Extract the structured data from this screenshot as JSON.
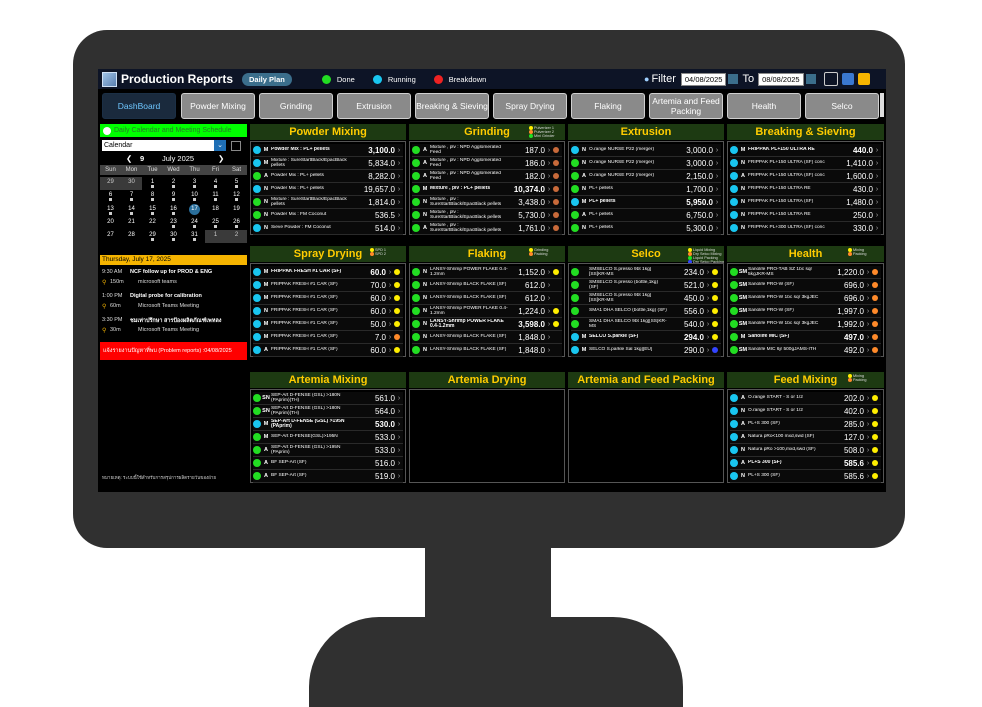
{
  "app": {
    "title": "Production Reports",
    "daily_plan": "Daily Plan",
    "legend": {
      "done": "Done",
      "running": "Running",
      "breakdown": "Breakdown"
    },
    "filter_label": "Filter",
    "date_from": "04/08/2025",
    "to_label": "To",
    "date_to": "08/08/2025"
  },
  "colors": {
    "done": "#22dd22",
    "running": "#19c6f0",
    "breakdown": "#ee2222",
    "yellow": "#ffee00",
    "orange": "#ff8a2a",
    "brown": "#c86a3a",
    "blue": "#3344ff",
    "header_bg": "#1d3a12",
    "header_text": "#ffcc00"
  },
  "tabs": [
    "DashBoard",
    "Powder Mixing",
    "Grinding",
    "Extrusion",
    "Breaking & Sieving",
    "Spray Drying",
    "Flaking",
    "Artemia and Feed Packing",
    "Health",
    "Selco"
  ],
  "calendar": {
    "header": "Daily Calendar and Meeting Schedule",
    "select": "Calendar",
    "day": "9",
    "month": "July 2025",
    "weekdays": [
      "Sun",
      "Mon",
      "Tue",
      "Wed",
      "Thu",
      "Fri",
      "Sat"
    ],
    "weeks": [
      [
        "29",
        "30",
        "1",
        "2",
        "3",
        "4",
        "5"
      ],
      [
        "6",
        "7",
        "8",
        "9",
        "10",
        "11",
        "12"
      ],
      [
        "13",
        "14",
        "15",
        "16",
        "17",
        "18",
        "19"
      ],
      [
        "20",
        "21",
        "22",
        "23",
        "24",
        "25",
        "26"
      ],
      [
        "27",
        "28",
        "29",
        "30",
        "31",
        "1",
        "2"
      ]
    ],
    "event_date": "Thursday, July 17, 2025",
    "events": [
      {
        "time": "9:30 AM",
        "title": "NCF follow up for PROD & ENG",
        "duration": "150m",
        "sub": "microsoft teams"
      },
      {
        "time": "1:00 PM",
        "title": "Digital probe for calibration",
        "duration": "60m",
        "sub": "Microsoft Teams Meeting"
      },
      {
        "time": "3:30 PM",
        "title": "ชมเท่าปรึกษา สารป้องผลิตภัณฑ์เพหลง",
        "duration": "30m",
        "sub": "Microsoft Teams Meeting"
      }
    ],
    "problem": "แจ้งรายงานปัญหาที่พบ (Problem reports) :04/08/2025",
    "footnote": "หมายเหตุ: ระบบนี้ใช้สำหรับการสรุปการผลิตรายวันของฝ่าย"
  },
  "sections": {
    "powder_mixing": {
      "title": "Powder Mixing",
      "rows": [
        {
          "code": "M",
          "name": "Powder Mix : PL+ pellets",
          "value": "3,100.0",
          "status": "running",
          "bold": true
        },
        {
          "code": "M",
          "name": "Mixture : SureStartBlack/EpacBlack pellets",
          "value": "5,834.0",
          "status": "running"
        },
        {
          "code": "A",
          "name": "Powder Mix : PL+ pellets",
          "value": "8,282.0",
          "status": "done"
        },
        {
          "code": "N",
          "name": "Powder Mix : PL+ pellets",
          "value": "19,657.0",
          "status": "running"
        },
        {
          "code": "N",
          "name": "Mixture : SureStartBlack/EpacBlack pellets",
          "value": "1,814.0",
          "status": "done"
        },
        {
          "code": "N",
          "name": "Powder Mix : FM Coconut",
          "value": "536.5",
          "status": "done"
        },
        {
          "code": "N",
          "name": "Sieve Powder : FM Coconut",
          "value": "514.0",
          "status": "running"
        }
      ]
    },
    "grinding": {
      "title": "Grinding",
      "legend": [
        "Pulverizer 1",
        "Pulverizer 2",
        "Mini Grinder"
      ],
      "rows": [
        {
          "code": "A",
          "name": "Mixture , plv : NPD Agglomerated Feed",
          "value": "187.0",
          "status": "done",
          "ind": "brown"
        },
        {
          "code": "A",
          "name": "Mixture , plv : NPD Agglomerated Feed",
          "value": "186.0",
          "status": "done",
          "ind": "brown"
        },
        {
          "code": "A",
          "name": "Mixture , plv : NPD Agglomerated Feed",
          "value": "182.0",
          "status": "done",
          "ind": "brown"
        },
        {
          "code": "M",
          "name": "Mixture , plv : PL+ pellets",
          "value": "10,374.0",
          "status": "done",
          "ind": "brown",
          "bold": true
        },
        {
          "code": "N",
          "name": "Mixture , plv : SureStartBlack/EpacBlack pellets",
          "value": "3,438.0",
          "status": "done",
          "ind": "brown"
        },
        {
          "code": "N",
          "name": "Mixture , plv : SureStartBlack/EpacBlack pellets",
          "value": "5,730.0",
          "status": "done",
          "ind": "brown"
        },
        {
          "code": "A",
          "name": "Mixture , plv : SureStartBlack/EpacBlack pellets",
          "value": "1,761.0",
          "status": "done",
          "ind": "brown"
        }
      ]
    },
    "extrusion": {
      "title": "Extrusion",
      "rows": [
        {
          "code": "N",
          "name": "O.range NURSE P22 (merger)",
          "value": "3,000.0",
          "status": "running"
        },
        {
          "code": "N",
          "name": "O.range NURSE P22 (merger)",
          "value": "3,000.0",
          "status": "done"
        },
        {
          "code": "A",
          "name": "O.range NURSE P22 (merger)",
          "value": "2,150.0",
          "status": "done"
        },
        {
          "code": "N",
          "name": "PL+ pellets",
          "value": "1,700.0",
          "status": "done"
        },
        {
          "code": "M",
          "name": "PL+ pellets",
          "value": "5,950.0",
          "status": "running",
          "bold": true
        },
        {
          "code": "A",
          "name": "PL+ pellets",
          "value": "6,750.0",
          "status": "done"
        },
        {
          "code": "N",
          "name": "PL+ pellets",
          "value": "5,300.0",
          "status": "done"
        }
      ]
    },
    "breaking": {
      "title": "Breaking & Sieving",
      "rows": [
        {
          "code": "M",
          "name": "FRIPPAK PL+150 ULTRA RE",
          "value": "440.0",
          "status": "running",
          "bold": true
        },
        {
          "code": "N",
          "name": "FRIPPAK PL+150 ULTRA (SF) conc",
          "value": "1,410.0",
          "status": "running"
        },
        {
          "code": "A",
          "name": "FRIPPAK PL+150 ULTRA (SF) conc",
          "value": "1,600.0",
          "status": "running"
        },
        {
          "code": "N",
          "name": "FRIPPAK PL+150 ULTRA RE",
          "value": "430.0",
          "status": "running"
        },
        {
          "code": "N",
          "name": "FRIPPAK PL+150 ULTRA (SF)",
          "value": "1,480.0",
          "status": "running"
        },
        {
          "code": "N",
          "name": "FRIPPAK PL+150 ULTRA RE",
          "value": "250.0",
          "status": "running"
        },
        {
          "code": "N",
          "name": "FRIPPAK PL+300 ULTRA (SF) conc",
          "value": "330.0",
          "status": "running"
        }
      ]
    },
    "spray_drying": {
      "title": "Spray Drying",
      "legend": [
        "SPD 1",
        "SPD 2"
      ],
      "rows": [
        {
          "code": "M",
          "name": "FRIPPAK FRESH #1 CAR (SF)",
          "value": "60.0",
          "status": "running",
          "ind": "yellow",
          "bold": true
        },
        {
          "code": "M",
          "name": "FRIPPAK FRESH #1 CAR (SF)",
          "value": "70.0",
          "status": "running",
          "ind": "yellow"
        },
        {
          "code": "M",
          "name": "FRIPPAK FRESH #1 CAR (SF)",
          "value": "60.0",
          "status": "running",
          "ind": "yellow"
        },
        {
          "code": "N",
          "name": "FRIPPAK FRESH #1 CAR (SF)",
          "value": "60.0",
          "status": "running",
          "ind": "yellow"
        },
        {
          "code": "M",
          "name": "FRIPPAK FRESH #1 CAR (SF)",
          "value": "50.0",
          "status": "running",
          "ind": "yellow"
        },
        {
          "code": "M",
          "name": "FRIPPAK FRESH #1 CAR (SF)",
          "value": "7.0",
          "status": "running",
          "ind": "orange"
        },
        {
          "code": "A",
          "name": "FRIPPAK FRESH #1 CAR (SF)",
          "value": "60.0",
          "status": "running",
          "ind": "yellow"
        }
      ]
    },
    "flaking": {
      "title": "Flaking",
      "legend": [
        "Grinding",
        "Packing"
      ],
      "rows": [
        {
          "code": "N",
          "name": "LANSY-Shrimp POWER FLAKE 0.4-1.2mm",
          "value": "1,152.0",
          "status": "done",
          "ind": "yellow"
        },
        {
          "code": "N",
          "name": "LANSY-Shrimp BLACK FLAKE (SF)",
          "value": "612.0",
          "status": "done",
          "ind": "none"
        },
        {
          "code": "N",
          "name": "LANSY-Shrimp BLACK FLAKE (SF)",
          "value": "612.0",
          "status": "done",
          "ind": "none"
        },
        {
          "code": "N",
          "name": "LANSY-Shrimp POWER FLAKE 0.4-1.2mm",
          "value": "1,224.0",
          "status": "done",
          "ind": "yellow"
        },
        {
          "code": "N",
          "name": "LANSY-Shrimp POWER FLAKE 0.4-1.2mm",
          "value": "3,598.0",
          "status": "done",
          "ind": "yellow",
          "bold": true
        },
        {
          "code": "N",
          "name": "LANSY-Shrimp BLACK FLAKE (SF)",
          "value": "1,848.0",
          "status": "done",
          "ind": "none"
        },
        {
          "code": "N",
          "name": "LANSY-Shrimp BLACK FLAKE (SF)",
          "value": "1,848.0",
          "status": "done",
          "ind": "none"
        }
      ]
    },
    "selco": {
      "title": "Selco",
      "legend": [
        "Liquid Mixing",
        "Dry Selco Mixing",
        "Liquid Packing",
        "Dry Selco Packing"
      ],
      "rows": [
        {
          "code": "",
          "name": "SMSELCO S.presso 9bt 1kg][SS]KR-MS",
          "value": "234.0",
          "status": "done",
          "ind": "yellow"
        },
        {
          "code": "",
          "name": "SMSELCO S.presso (bottle,1kg) (SF)",
          "value": "521.0",
          "status": "done",
          "ind": "yellow"
        },
        {
          "code": "",
          "name": "SMSELCO S.presso 9bt 1kg][SS]KR-MS",
          "value": "450.0",
          "status": "done",
          "ind": "yellow"
        },
        {
          "code": "",
          "name": "SMA1 DHA SELCO (bottle,1kg) (SF)",
          "value": "556.0",
          "status": "done",
          "ind": "yellow"
        },
        {
          "code": "",
          "name": "SMA1 DHA SELCO 9bt 1kg][SS]KR-MS",
          "value": "540.0",
          "status": "done",
          "ind": "yellow"
        },
        {
          "code": "M",
          "name": "SELCO S.parkle (SF)",
          "value": "294.0",
          "status": "running",
          "ind": "yellow",
          "bold": true
        },
        {
          "code": "M",
          "name": "SELCO S.parkle Sal 1kg][EU]",
          "value": "290.0",
          "status": "running",
          "ind": "blue"
        }
      ]
    },
    "health": {
      "title": "Health",
      "legend": [
        "Mixing",
        "Packing"
      ],
      "rows": [
        {
          "code": "SM",
          "name": "Sanolife PRO-TAB SZ 1bc sqr 5kgJKR-MS",
          "value": "1,220.0",
          "status": "done",
          "ind": "orange"
        },
        {
          "code": "SM",
          "name": "Sanolife PRO-W (SF)",
          "value": "696.0",
          "status": "done",
          "ind": "orange"
        },
        {
          "code": "SM",
          "name": "Sanolife PRO-W 1bc sqr 3kgJEC",
          "value": "696.0",
          "status": "done",
          "ind": "orange"
        },
        {
          "code": "SM",
          "name": "Sanolife PRO-W (SF)",
          "value": "1,997.0",
          "status": "done",
          "ind": "orange"
        },
        {
          "code": "SM",
          "name": "Sanolife PRO-W 1bc sqr 3kgJEC",
          "value": "1,992.0",
          "status": "done",
          "ind": "orange"
        },
        {
          "code": "M",
          "name": "Sanolife MIC (SF)",
          "value": "497.0",
          "status": "done",
          "ind": "orange",
          "bold": true
        },
        {
          "code": "SM",
          "name": "Sanolife MIC 6jr 500gJAMS-ITH",
          "value": "492.0",
          "status": "done",
          "ind": "orange"
        }
      ]
    },
    "artemia_mixing": {
      "title": "Artemia Mixing",
      "rows": [
        {
          "code": "SN",
          "name": "SEP-Art D-FENSE (GSL) >180N (PAprim)(TH)",
          "value": "561.0",
          "status": "done"
        },
        {
          "code": "SN",
          "name": "SEP-Art D-FENSE (GSL) >180N (PAprim)(TH)",
          "value": "564.0",
          "status": "done"
        },
        {
          "code": "M",
          "name": "SEP-Art D-FENSE (GSL) >195N (PAprim)",
          "value": "530.0",
          "status": "running",
          "bold": true
        },
        {
          "code": "M",
          "name": "SEP-Art D-FENSE(GSL)>195N",
          "value": "533.0",
          "status": "done"
        },
        {
          "code": "A",
          "name": "SEP-Art D-FENSE (GSL) >195N (PAprim)",
          "value": "533.0",
          "status": "done"
        },
        {
          "code": "A",
          "name": "BF SEP-Art (SF)",
          "value": "516.0",
          "status": "done"
        },
        {
          "code": "A",
          "name": "BF SEP-Art (SF)",
          "value": "519.0",
          "status": "done"
        }
      ]
    },
    "artemia_drying": {
      "title": "Artemia Drying"
    },
    "artemia_packing": {
      "title": "Artemia and Feed Packing"
    },
    "feed_mixing": {
      "title": "Feed Mixing",
      "legend": [
        "Mixing",
        "Packing"
      ],
      "rows": [
        {
          "code": "A",
          "name": "O.range START - S or 1/2",
          "value": "202.0",
          "status": "running",
          "ind": "yellow"
        },
        {
          "code": "N",
          "name": "O.range START - S or 1/2",
          "value": "402.0",
          "status": "running",
          "ind": "yellow"
        },
        {
          "code": "A",
          "name": "PL+S 300 (SF)",
          "value": "285.0",
          "status": "running",
          "ind": "yellow"
        },
        {
          "code": "A",
          "name": "Natura pRo<100 mxd,swd (SF)",
          "value": "127.0",
          "status": "running",
          "ind": "yellow"
        },
        {
          "code": "N",
          "name": "Natura pRo >100,mxd,swd (SF)",
          "value": "508.0",
          "status": "running",
          "ind": "yellow"
        },
        {
          "code": "A",
          "name": "PL+S 300 (SF)",
          "value": "585.6",
          "status": "running",
          "ind": "yellow",
          "bold": true
        },
        {
          "code": "N",
          "name": "PL+S 300 (SF)",
          "value": "585.6",
          "status": "running",
          "ind": "yellow"
        }
      ]
    }
  }
}
